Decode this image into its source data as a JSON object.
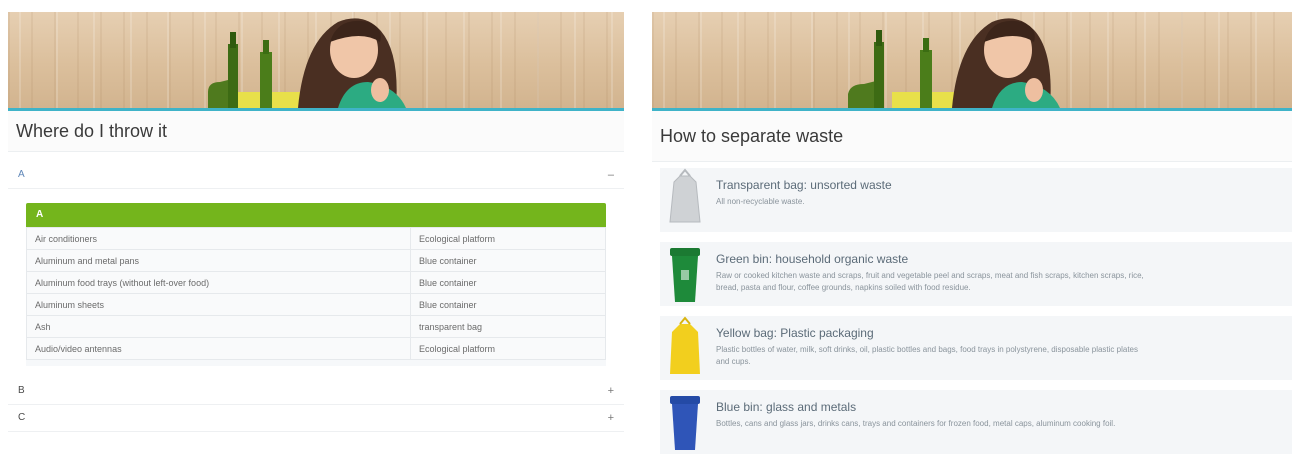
{
  "where": {
    "title": "Where do I throw it",
    "open_section": {
      "letter": "A",
      "toggle": "–",
      "bar_label": "A",
      "rows": [
        {
          "item": "Air conditioners",
          "destination": "Ecological platform"
        },
        {
          "item": "Aluminum and metal pans",
          "destination": "Blue container"
        },
        {
          "item": "Aluminum food trays (without left-over food)",
          "destination": "Blue container"
        },
        {
          "item": "Aluminum sheets",
          "destination": "Blue container"
        },
        {
          "item": "Ash",
          "destination": "transparent bag"
        },
        {
          "item": "Audio/video antennas",
          "destination": "Ecological platform"
        }
      ]
    },
    "collapsed_sections": [
      {
        "letter": "B",
        "toggle": "+"
      },
      {
        "letter": "C",
        "toggle": "+"
      }
    ]
  },
  "separate": {
    "title": "How to separate waste",
    "items": [
      {
        "title": "Transparent bag: unsorted waste",
        "desc": "All non-recyclable waste.",
        "icon": "transparent-bag-icon",
        "color": "#c9cccf"
      },
      {
        "title": "Green bin: household organic waste",
        "desc": "Raw or cooked kitchen waste and scraps, fruit and vegetable peel and scraps, meat and fish scraps, kitchen scraps, rice,",
        "desc2": "bread, pasta and flour, coffee grounds, napkins soiled with food residue.",
        "icon": "green-bin-icon",
        "color": "#1e8a3a"
      },
      {
        "title": "Yellow bag: Plastic packaging",
        "desc": "Plastic bottles of water, milk, soft drinks, oil, plastic bottles and bags, food trays in polystyrene, disposable plastic plates",
        "desc2": "and cups.",
        "icon": "yellow-bag-icon",
        "color": "#f2cf1e"
      },
      {
        "title": "Blue bin: glass and metals",
        "desc": "Bottles, cans and glass jars, drinks cans, trays and containers for frozen food, metal caps, aluminum cooking foil.",
        "icon": "blue-bin-icon",
        "color": "#2f55b8"
      }
    ]
  },
  "colors": {
    "accent_green": "#74b51c",
    "banner_stripe": "#3fb3c8",
    "link_blue": "#5f87b8"
  }
}
